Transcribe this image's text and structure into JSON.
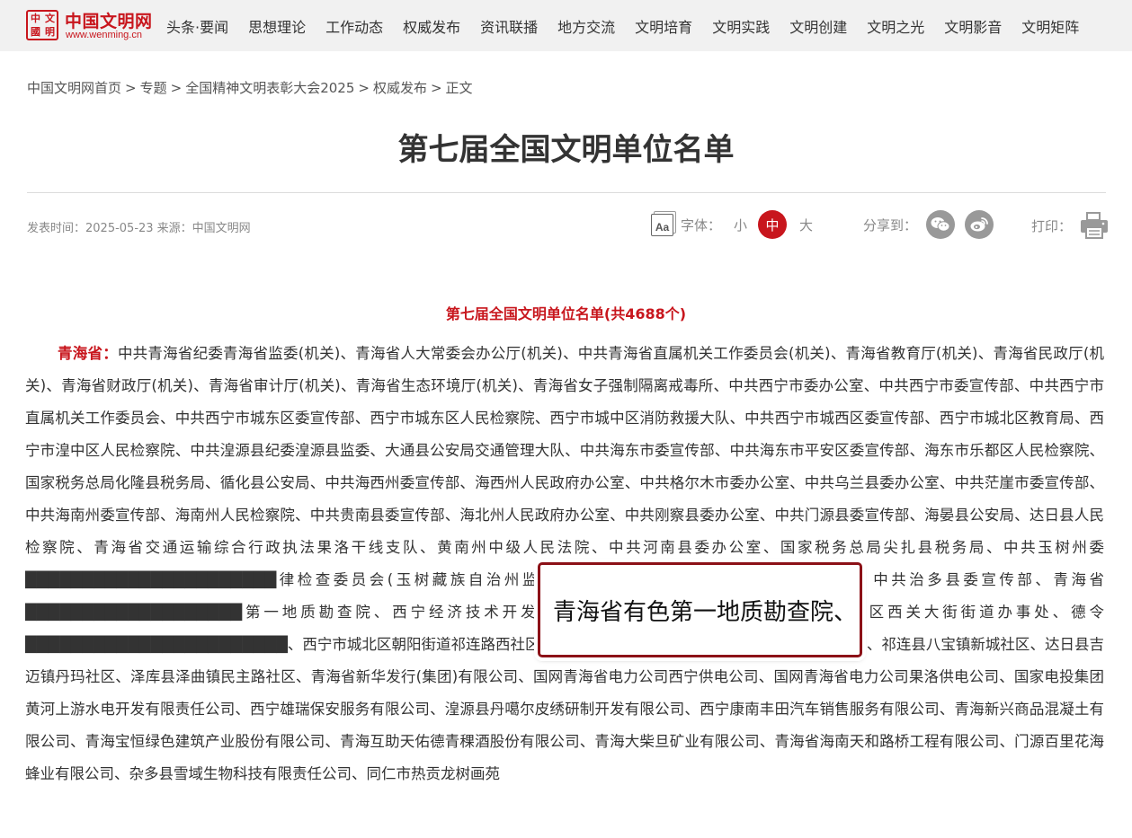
{
  "header": {
    "logo": {
      "seal_chars": [
        "中",
        "文",
        "國",
        "明"
      ],
      "name": "中国文明网",
      "url": "www.wenming.cn"
    },
    "nav": [
      "头条·要闻",
      "思想理论",
      "工作动态",
      "权威发布",
      "资讯联播",
      "地方交流",
      "文明培育",
      "文明实践",
      "文明创建",
      "文明之光",
      "文明影音",
      "文明矩阵"
    ]
  },
  "breadcrumb": [
    "中国文明网首页",
    "专题",
    "全国精神文明表彰大会2025",
    "权威发布",
    "正文"
  ],
  "breadcrumb_separator": ">",
  "article": {
    "title": "第七届全国文明单位名单",
    "meta": "发表时间：2025-05-23 来源：中国文明网",
    "font_size": {
      "icon_text": "Aa",
      "label": "字体：",
      "small": "小",
      "medium": "中",
      "large": "大",
      "selected": "中"
    },
    "share_label": "分享到：",
    "print_label": "打印：",
    "list_heading": "第七届全国文明单位名单(共4688个)",
    "province": "青海省：",
    "body": "中共青海省纪委青海省监委(机关)、青海省人大常委会办公厅(机关)、中共青海省直属机关工作委员会(机关)、青海省教育厅(机关)、青海省民政厅(机关)、青海省财政厅(机关)、青海省审计厅(机关)、青海省生态环境厅(机关)、青海省女子强制隔离戒毒所、中共西宁市委办公室、中共西宁市委宣传部、中共西宁市直属机关工作委员会、中共西宁市城东区委宣传部、西宁市城东区人民检察院、西宁市城中区消防救援大队、中共西宁市城西区委宣传部、西宁市城北区教育局、西宁市湟中区人民检察院、中共湟源县纪委湟源县监委、大通县公安局交通管理大队、中共海东市委宣传部、中共海东市平安区委宣传部、海东市乐都区人民检察院、国家税务总局化隆县税务局、循化县公安局、中共海西州委宣传部、海西州人民政府办公室、中共格尔木市委办公室、中共乌兰县委办公室、中共茫崖市委宣传部、中共海南州委宣传部、海南州人民检察院、中共贵南县委宣传部、海北州人民政府办公室、中共刚察县委办公室、中共门源县委宣传部、海晏县公安局、达日县人民检察院、青海省交通运输综合行政执法果洛干线支队、黄南州中级人民法院、中共河南县委办公室、国家税务总局尖扎县税务局、中共玉树州委██████████████████████律检查委员会(玉树藏族自治州监察委员会)、玉树藏族自治州人民检察院、中共治多县委宣传部、青海省███████████████████第一地质勘查院、西宁经济技术开发区东川工业园区管理委员会、西宁市城西区西关大街街道办事处、德令███████████████████████、西宁市城北区朝阳街道祁连路西社区、民和县川口镇海鸿社区、贵德县河阴镇古城社区、祁连县八宝镇新城社区、达日县吉迈镇丹玛社区、泽库县泽曲镇民主路社区、青海省新华发行(集团)有限公司、国网青海省电力公司西宁供电公司、国网青海省电力公司果洛供电公司、国家电投集团黄河上游水电开发有限责任公司、西宁雄瑞保安服务有限公司、湟源县丹噶尔皮绣研制开发有限公司、西宁康南丰田汽车销售服务有限公司、青海新兴商品混凝土有限公司、青海宝恒绿色建筑产业股份有限公司、青海互助天佑德青稞酒股份有限公司、青海大柴旦矿业有限公司、青海省海南天和路桥工程有限公司、门源百里花海蜂业有限公司、杂多县雪域生物科技有限责任公司、同仁市热贡龙树画苑"
  },
  "zoom_overlay": {
    "text": "青海省有色第一地质勘查院、"
  },
  "colors": {
    "brand_red": "#c8161d",
    "overlay_border": "#8c1117",
    "nav_bg": "#f1f1f1"
  },
  "icons": [
    "font-size-icon",
    "wechat-icon",
    "weibo-icon",
    "printer-icon"
  ]
}
